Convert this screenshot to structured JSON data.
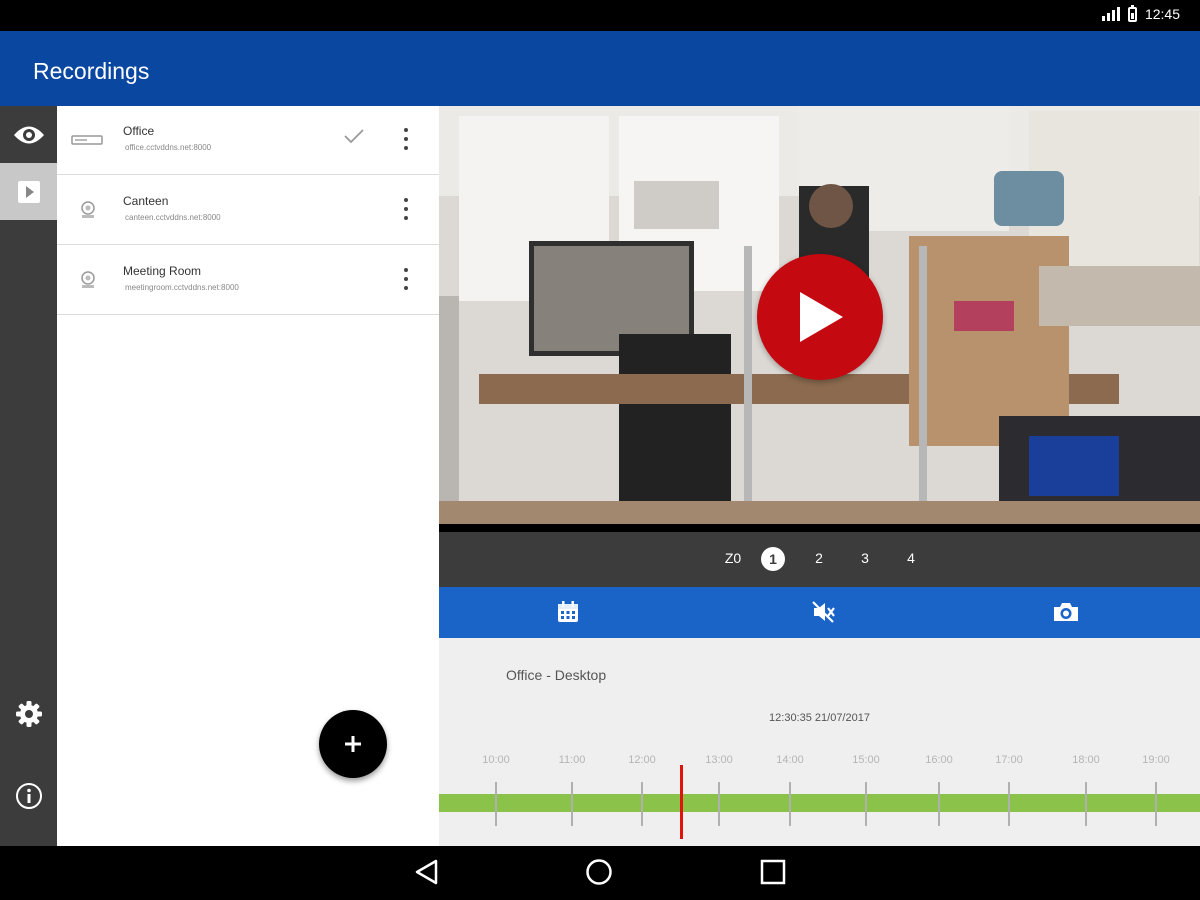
{
  "status_bar": {
    "time": "12:45"
  },
  "app_bar": {
    "title": "Recordings"
  },
  "nav_rail": {
    "items": [
      "live-view",
      "recordings",
      "settings",
      "info"
    ],
    "active": "recordings"
  },
  "devices": [
    {
      "name": "Office",
      "address": "office.cctvddns.net:8000",
      "selected": true,
      "icon": "dvr-icon"
    },
    {
      "name": "Canteen",
      "address": "canteen.cctvddns.net:8000",
      "selected": false,
      "icon": "camera-icon"
    },
    {
      "name": "Meeting Room",
      "address": "meetingroom.cctvddns.net:8000",
      "selected": false,
      "icon": "camera-icon"
    }
  ],
  "fab": {
    "icon": "plus-icon"
  },
  "video": {
    "play_icon": "play-icon"
  },
  "streams": {
    "items": [
      "Z0",
      "1",
      "2",
      "3",
      "4"
    ],
    "selected": "1"
  },
  "toolbar": {
    "icons": [
      "calendar-icon",
      "mute-icon",
      "camera-snapshot-icon"
    ]
  },
  "timeline": {
    "camera": "Office - Desktop",
    "current": "12:30:35   21/07/2017",
    "hours": [
      "10:00",
      "11:00",
      "12:00",
      "13:00",
      "14:00",
      "15:00",
      "16:00",
      "17:00",
      "18:00",
      "19:00"
    ]
  },
  "colors": {
    "app_bar": "#0a47a0",
    "toolbar": "#1a64c8",
    "play": "#c40910",
    "track": "#8bc34a",
    "cursor": "#e0140c"
  }
}
